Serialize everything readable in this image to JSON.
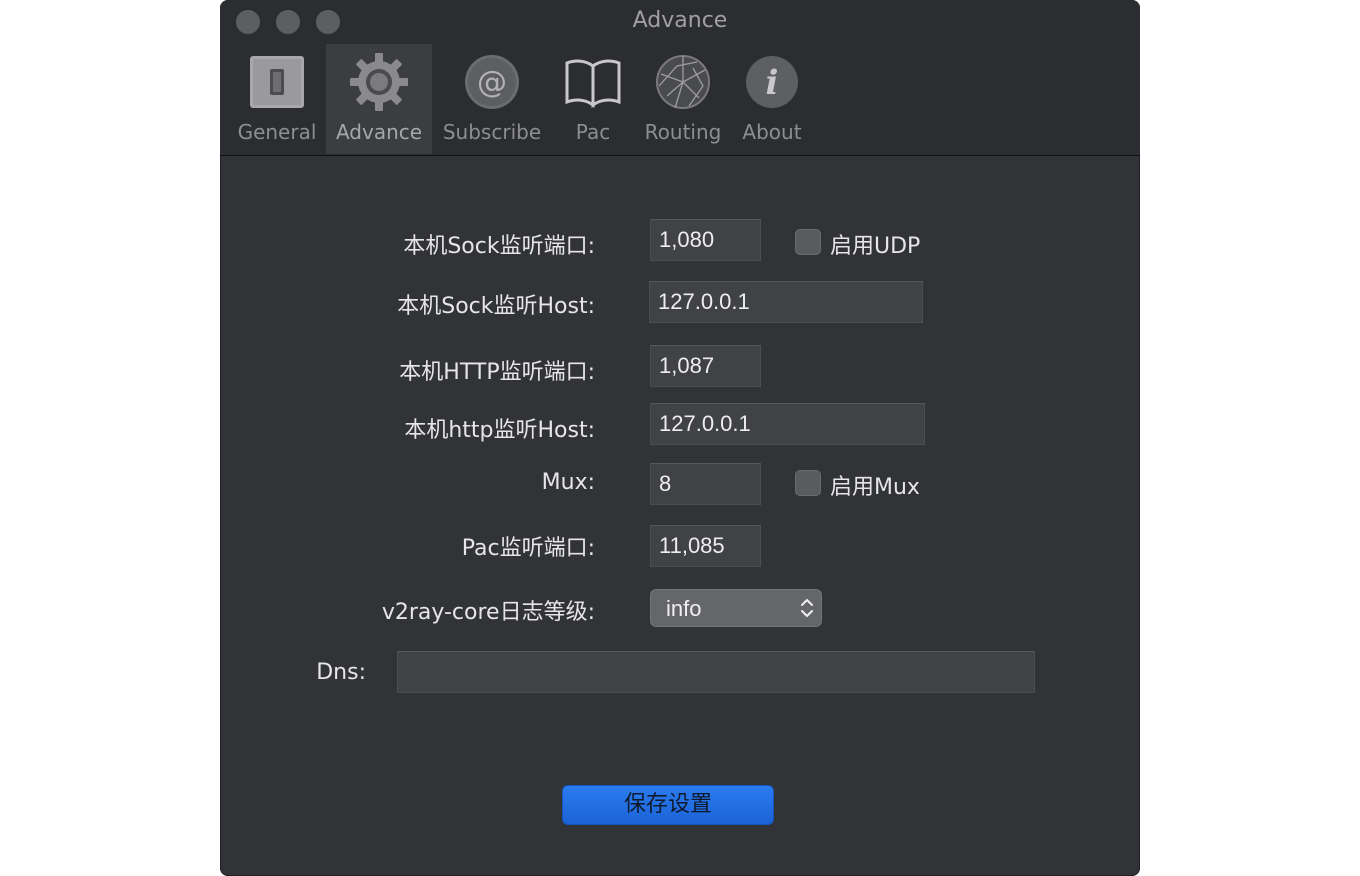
{
  "window": {
    "title": "Advance"
  },
  "tabs": [
    {
      "label": "General",
      "icon": "switch-icon"
    },
    {
      "label": "Advance",
      "icon": "gear-icon"
    },
    {
      "label": "Subscribe",
      "icon": "at-sign-icon"
    },
    {
      "label": "Pac",
      "icon": "book-icon"
    },
    {
      "label": "Routing",
      "icon": "globe-network-icon"
    },
    {
      "label": "About",
      "icon": "info-icon"
    }
  ],
  "form": {
    "sock_port": {
      "label": "本机Sock监听端口:",
      "value": "1,080"
    },
    "udp": {
      "label": "启用UDP",
      "checked": false
    },
    "sock_host": {
      "label": "本机Sock监听Host:",
      "value": "127.0.0.1"
    },
    "http_port": {
      "label": "本机HTTP监听端口:",
      "value": "1,087"
    },
    "http_host": {
      "label": "本机http监听Host:",
      "value": "127.0.0.1"
    },
    "mux": {
      "label": "Mux:",
      "value": "8"
    },
    "mux_enable": {
      "label": "启用Mux",
      "checked": false
    },
    "pac_port": {
      "label": "Pac监听端口:",
      "value": "11,085"
    },
    "log_level": {
      "label": "v2ray-core日志等级:",
      "value": "info"
    },
    "dns": {
      "label": "Dns:",
      "value": ""
    }
  },
  "save_button": {
    "label": "保存设置"
  },
  "colors": {
    "window_bg": "#323337",
    "accent": "#1f6ce0",
    "field_bg": "#414246"
  }
}
